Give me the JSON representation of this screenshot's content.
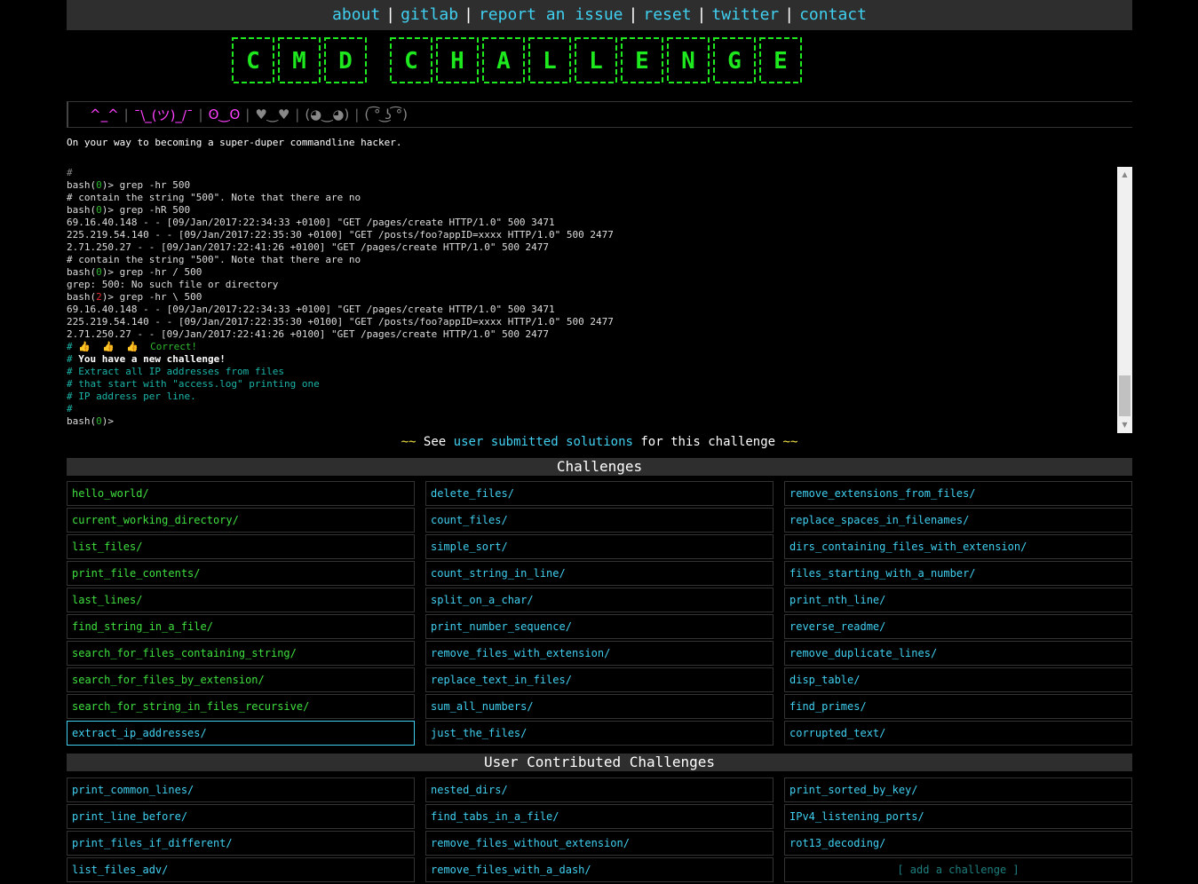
{
  "nav": {
    "items": [
      "about",
      "gitlab",
      "report an issue",
      "reset",
      "twitter",
      "contact"
    ],
    "separator": "|"
  },
  "banner": {
    "text": "CMD CHALLENGE",
    "color": "#1ee81e"
  },
  "emoji_bar": {
    "items": [
      {
        "text": "^_^",
        "color": "#ff40ff"
      },
      {
        "text": "¯\\_(ツ)_/¯",
        "color": "#ff40ff"
      },
      {
        "text": "ʘ‿ʘ",
        "color": "#ff40ff"
      },
      {
        "text": "♥‿♥",
        "color": "#888888"
      },
      {
        "text": "(◕‿◕)",
        "color": "#888888"
      },
      {
        "text": "( ͡° ͜ʖ ͡°)",
        "color": "#888888"
      }
    ]
  },
  "tagline": "On your way to becoming a super-duper commandline hacker.",
  "terminal": {
    "lines": [
      [
        {
          "t": "#",
          "c": "c-comment"
        }
      ],
      [
        {
          "t": "bash(",
          "c": ""
        },
        {
          "t": "0",
          "c": "c-green"
        },
        {
          "t": ")> grep -hr 500",
          "c": ""
        }
      ],
      [
        {
          "t": "# contain the string \"500\". Note that there are no",
          "c": ""
        }
      ],
      [
        {
          "t": "bash(",
          "c": ""
        },
        {
          "t": "0",
          "c": "c-green"
        },
        {
          "t": ")> grep -hR 500",
          "c": ""
        }
      ],
      [
        {
          "t": "69.16.40.148 - - [09/Jan/2017:22:34:33 +0100] \"GET /pages/create HTTP/1.0\" 500 3471",
          "c": ""
        }
      ],
      [
        {
          "t": "225.219.54.140 - - [09/Jan/2017:22:35:30 +0100] \"GET /posts/foo?appID=xxxx HTTP/1.0\" 500 2477",
          "c": ""
        }
      ],
      [
        {
          "t": "2.71.250.27 - - [09/Jan/2017:22:41:26 +0100] \"GET /pages/create HTTP/1.0\" 500 2477",
          "c": ""
        }
      ],
      [
        {
          "t": "# contain the string \"500\". Note that there are no",
          "c": ""
        }
      ],
      [
        {
          "t": "bash(",
          "c": ""
        },
        {
          "t": "0",
          "c": "c-green"
        },
        {
          "t": ")> grep -hr / 500",
          "c": ""
        }
      ],
      [
        {
          "t": "grep: 500: No such file or directory",
          "c": ""
        }
      ],
      [
        {
          "t": "bash(",
          "c": ""
        },
        {
          "t": "2",
          "c": "c-red"
        },
        {
          "t": ")> grep -hr \\ 500",
          "c": ""
        }
      ],
      [
        {
          "t": "69.16.40.148 - - [09/Jan/2017:22:34:33 +0100] \"GET /pages/create HTTP/1.0\" 500 3471",
          "c": ""
        }
      ],
      [
        {
          "t": "225.219.54.140 - - [09/Jan/2017:22:35:30 +0100] \"GET /posts/foo?appID=xxxx HTTP/1.0\" 500 2477",
          "c": ""
        }
      ],
      [
        {
          "t": "2.71.250.27 - - [09/Jan/2017:22:41:26 +0100] \"GET /pages/create HTTP/1.0\" 500 2477",
          "c": ""
        }
      ],
      [
        {
          "t": "# ",
          "c": "c-cyan"
        },
        {
          "t": "👍  👍  👍  ",
          "c": "c-green"
        },
        {
          "t": "Correct!",
          "c": "c-green"
        }
      ],
      [
        {
          "t": "# ",
          "c": "c-cyan"
        },
        {
          "t": "You have a new challenge!",
          "c": "c-white-bold"
        }
      ],
      [
        {
          "t": "# Extract all IP addresses from files",
          "c": "c-cyan"
        }
      ],
      [
        {
          "t": "# that start with \"access.log\" printing one",
          "c": "c-cyan"
        }
      ],
      [
        {
          "t": "# IP address per line.",
          "c": "c-cyan"
        }
      ],
      [
        {
          "t": "#",
          "c": "c-cyan"
        }
      ],
      [
        {
          "t": "bash(",
          "c": ""
        },
        {
          "t": "0",
          "c": "c-green"
        },
        {
          "t": ")>",
          "c": ""
        }
      ]
    ]
  },
  "see_solutions": {
    "wave": "~~",
    "prefix": "See",
    "link": "user submitted solutions",
    "suffix": "for this challenge"
  },
  "challenges": {
    "title": "Challenges",
    "columns": [
      [
        "hello_world/",
        "current_working_directory/",
        "list_files/",
        "print_file_contents/",
        "last_lines/",
        "find_string_in_a_file/",
        "search_for_files_containing_string/",
        "search_for_files_by_extension/",
        "search_for_string_in_files_recursive/",
        "extract_ip_addresses/"
      ],
      [
        "delete_files/",
        "count_files/",
        "simple_sort/",
        "count_string_in_line/",
        "split_on_a_char/",
        "print_number_sequence/",
        "remove_files_with_extension/",
        "replace_text_in_files/",
        "sum_all_numbers/",
        "just_the_files/"
      ],
      [
        "remove_extensions_from_files/",
        "replace_spaces_in_filenames/",
        "dirs_containing_files_with_extension/",
        "files_starting_with_a_number/",
        "print_nth_line/",
        "reverse_readme/",
        "remove_duplicate_lines/",
        "disp_table/",
        "find_primes/",
        "corrupted_text/"
      ]
    ],
    "completed_count": 9,
    "active": "extract_ip_addresses/"
  },
  "user_challenges": {
    "title": "User Contributed Challenges",
    "columns": [
      [
        "print_common_lines/",
        "print_line_before/",
        "print_files_if_different/",
        "list_files_adv/"
      ],
      [
        "nested_dirs/",
        "find_tabs_in_a_file/",
        "remove_files_without_extension/",
        "remove_files_with_a_dash/"
      ],
      [
        "print_sorted_by_key/",
        "IPv4_listening_ports/",
        "rot13_decoding/"
      ]
    ],
    "add_label": "[ add a challenge ]"
  }
}
